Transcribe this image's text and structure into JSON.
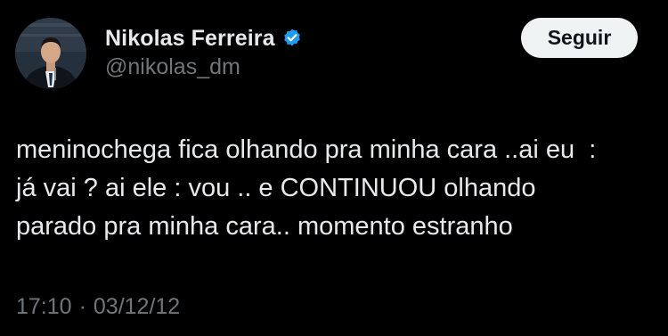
{
  "author": {
    "display_name": "Nikolas Ferreira",
    "handle": "@nikolas_dm",
    "verified": true,
    "verified_icon": "verified-badge-icon",
    "avatar_icon": "profile-photo"
  },
  "actions": {
    "follow_label": "Seguir"
  },
  "tweet": {
    "text": "meninochega fica olhando pra minha cara ..ai eu  :\njá vai ? ai ele : vou .. e CONTINUOU olhando\nparado pra minha cara.. momento estranho"
  },
  "meta": {
    "time": "17:10",
    "separator": "·",
    "date": "03/12/12"
  },
  "colors": {
    "background": "#000000",
    "primary_text": "#e7e9ea",
    "secondary_text": "#71767b",
    "verified_blue": "#1d9bf0",
    "button_bg": "#eff3f4",
    "button_text": "#0f1419"
  }
}
